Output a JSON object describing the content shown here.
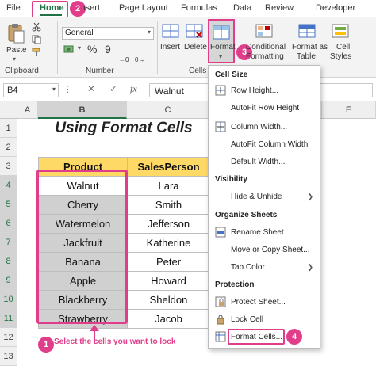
{
  "tabs": [
    {
      "label": "File"
    },
    {
      "label": "Home"
    },
    {
      "label": "Insert"
    },
    {
      "label": "Page Layout"
    },
    {
      "label": "Formulas"
    },
    {
      "label": "Data"
    },
    {
      "label": "Review"
    },
    {
      "label": "Developer"
    }
  ],
  "steps": {
    "one": "1",
    "two": "2",
    "three": "3",
    "four": "4"
  },
  "ribbon": {
    "paste": "Paste",
    "clipboard": "Clipboard",
    "number_format": "General",
    "percent": "%",
    "comma": "9",
    "number": "Number",
    "insert": "Insert",
    "delete": "Delete",
    "format": "Format",
    "cells": "Cells",
    "conditional_1": "Conditional",
    "conditional_2": "Formatting",
    "format_as_1": "Format as",
    "format_as_2": "Table",
    "cell_styles_1": "Cell",
    "cell_styles_2": "Styles"
  },
  "formula_bar": {
    "name_box": "B4",
    "fx": "fx",
    "value": "Walnut"
  },
  "columns": [
    "A",
    "B",
    "C",
    "D",
    "E"
  ],
  "rows": [
    "1",
    "2",
    "3",
    "4",
    "5",
    "6",
    "7",
    "8",
    "9",
    "10",
    "11",
    "12",
    "13"
  ],
  "title": "Using Format Cells",
  "table": {
    "headers": [
      "Product",
      "SalesPerson"
    ],
    "rows": [
      [
        "Walnut",
        "Lara"
      ],
      [
        "Cherry",
        "Smith"
      ],
      [
        "Watermelon",
        "Jefferson"
      ],
      [
        "Jackfruit",
        "Katherine"
      ],
      [
        "Banana",
        "Peter"
      ],
      [
        "Apple",
        "Howard"
      ],
      [
        "Blackberry",
        "Sheldon"
      ],
      [
        "Strawberry",
        "Jacob"
      ]
    ]
  },
  "annotation": "Select the cells you want to lock",
  "watermark": "exceldemy",
  "menu": {
    "cell_size": "Cell Size",
    "row_height": "Row Height...",
    "autofit_row": "AutoFit Row Height",
    "column_width": "Column Width...",
    "autofit_column": "AutoFit Column Width",
    "default_width": "Default Width...",
    "visibility": "Visibility",
    "hide_unhide": "Hide & Unhide",
    "organize": "Organize Sheets",
    "rename": "Rename Sheet",
    "move_copy": "Move or Copy Sheet...",
    "tab_color": "Tab Color",
    "protection": "Protection",
    "protect_sheet": "Protect Sheet...",
    "lock_cell": "Lock Cell",
    "format_cells": "Format Cells..."
  },
  "colors": {
    "accent": "#e03d8a",
    "header_fill": "#ffd966",
    "selected_fill": "#d0d0d0",
    "excel_green": "#217346"
  }
}
